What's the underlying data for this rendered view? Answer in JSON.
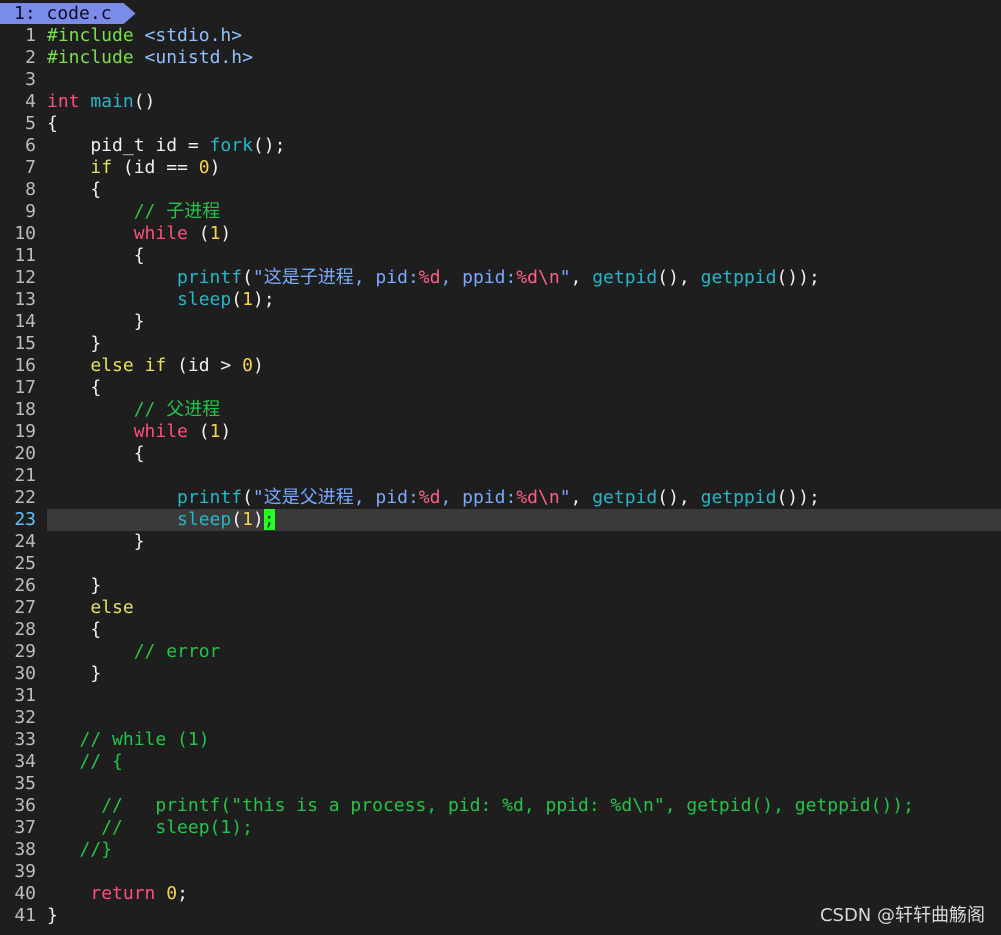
{
  "app": {
    "tab_label": "1: code.c",
    "watermark": "CSDN @轩轩曲觞阁",
    "current_line": 23
  },
  "colors": {
    "background": "#1e1e1e",
    "line_number": "#bdbdbd",
    "current_line_number": "#66c2ff",
    "preprocessor": "#79e04a",
    "include_path": "#8fc1ff",
    "keyword": "#ff4f7a",
    "control": "#e6e05a",
    "function": "#25b6c8",
    "number": "#f4d547",
    "comment": "#22c54a",
    "string": "#7aa8ff",
    "format_specifier": "#ff5f86",
    "cursor": "#22ff22"
  },
  "lines": [
    {
      "number": "1",
      "tokens": [
        {
          "text": "#include",
          "type": "pre"
        },
        {
          "text": " ",
          "type": "txt"
        },
        {
          "text": "<stdio.h>",
          "type": "inc"
        }
      ]
    },
    {
      "number": "2",
      "tokens": [
        {
          "text": "#include",
          "type": "pre"
        },
        {
          "text": " ",
          "type": "txt"
        },
        {
          "text": "<unistd.h>",
          "type": "inc"
        }
      ]
    },
    {
      "number": "3",
      "tokens": []
    },
    {
      "number": "4",
      "tokens": [
        {
          "text": "int",
          "type": "kw"
        },
        {
          "text": " ",
          "type": "txt"
        },
        {
          "text": "main",
          "type": "fn"
        },
        {
          "text": "()",
          "type": "txt"
        }
      ]
    },
    {
      "number": "5",
      "tokens": [
        {
          "text": "{",
          "type": "txt"
        }
      ]
    },
    {
      "number": "6",
      "tokens": [
        {
          "text": "    pid_t id = ",
          "type": "txt"
        },
        {
          "text": "fork",
          "type": "fn"
        },
        {
          "text": "();",
          "type": "txt"
        }
      ]
    },
    {
      "number": "7",
      "tokens": [
        {
          "text": "    ",
          "type": "txt"
        },
        {
          "text": "if",
          "type": "ctl"
        },
        {
          "text": " (id == ",
          "type": "txt"
        },
        {
          "text": "0",
          "type": "num"
        },
        {
          "text": ")",
          "type": "txt"
        }
      ]
    },
    {
      "number": "8",
      "tokens": [
        {
          "text": "    {",
          "type": "txt"
        }
      ]
    },
    {
      "number": "9",
      "tokens": [
        {
          "text": "        ",
          "type": "txt"
        },
        {
          "text": "// 子进程",
          "type": "com"
        }
      ]
    },
    {
      "number": "10",
      "tokens": [
        {
          "text": "        ",
          "type": "txt"
        },
        {
          "text": "while",
          "type": "kw"
        },
        {
          "text": " (",
          "type": "txt"
        },
        {
          "text": "1",
          "type": "num"
        },
        {
          "text": ")",
          "type": "txt"
        }
      ]
    },
    {
      "number": "11",
      "tokens": [
        {
          "text": "        {",
          "type": "txt"
        }
      ]
    },
    {
      "number": "12",
      "tokens": [
        {
          "text": "            ",
          "type": "txt"
        },
        {
          "text": "printf",
          "type": "fn"
        },
        {
          "text": "(",
          "type": "txt"
        },
        {
          "text": "\"这是子进程, pid:",
          "type": "str"
        },
        {
          "text": "%d",
          "type": "esc"
        },
        {
          "text": ", ppid:",
          "type": "str"
        },
        {
          "text": "%d\\n",
          "type": "esc"
        },
        {
          "text": "\"",
          "type": "str"
        },
        {
          "text": ", ",
          "type": "txt"
        },
        {
          "text": "getpid",
          "type": "fn"
        },
        {
          "text": "(), ",
          "type": "txt"
        },
        {
          "text": "getppid",
          "type": "fn"
        },
        {
          "text": "());",
          "type": "txt"
        }
      ]
    },
    {
      "number": "13",
      "tokens": [
        {
          "text": "            ",
          "type": "txt"
        },
        {
          "text": "sleep",
          "type": "fn"
        },
        {
          "text": "(",
          "type": "txt"
        },
        {
          "text": "1",
          "type": "num"
        },
        {
          "text": ");",
          "type": "txt"
        }
      ]
    },
    {
      "number": "14",
      "tokens": [
        {
          "text": "        }",
          "type": "txt"
        }
      ]
    },
    {
      "number": "15",
      "tokens": [
        {
          "text": "    }",
          "type": "txt"
        }
      ]
    },
    {
      "number": "16",
      "tokens": [
        {
          "text": "    ",
          "type": "txt"
        },
        {
          "text": "else",
          "type": "ctl"
        },
        {
          "text": " ",
          "type": "txt"
        },
        {
          "text": "if",
          "type": "ctl"
        },
        {
          "text": " (id > ",
          "type": "txt"
        },
        {
          "text": "0",
          "type": "num"
        },
        {
          "text": ")",
          "type": "txt"
        }
      ]
    },
    {
      "number": "17",
      "tokens": [
        {
          "text": "    {",
          "type": "txt"
        }
      ]
    },
    {
      "number": "18",
      "tokens": [
        {
          "text": "        ",
          "type": "txt"
        },
        {
          "text": "// 父进程",
          "type": "com"
        }
      ]
    },
    {
      "number": "19",
      "tokens": [
        {
          "text": "        ",
          "type": "txt"
        },
        {
          "text": "while",
          "type": "kw"
        },
        {
          "text": " (",
          "type": "txt"
        },
        {
          "text": "1",
          "type": "num"
        },
        {
          "text": ")",
          "type": "txt"
        }
      ]
    },
    {
      "number": "20",
      "tokens": [
        {
          "text": "        {",
          "type": "txt"
        }
      ]
    },
    {
      "number": "21",
      "tokens": []
    },
    {
      "number": "22",
      "tokens": [
        {
          "text": "            ",
          "type": "txt"
        },
        {
          "text": "printf",
          "type": "fn"
        },
        {
          "text": "(",
          "type": "txt"
        },
        {
          "text": "\"这是父进程, pid:",
          "type": "str"
        },
        {
          "text": "%d",
          "type": "esc"
        },
        {
          "text": ", ppid:",
          "type": "str"
        },
        {
          "text": "%d\\n",
          "type": "esc"
        },
        {
          "text": "\"",
          "type": "str"
        },
        {
          "text": ", ",
          "type": "txt"
        },
        {
          "text": "getpid",
          "type": "fn"
        },
        {
          "text": "(), ",
          "type": "txt"
        },
        {
          "text": "getppid",
          "type": "fn"
        },
        {
          "text": "());",
          "type": "txt"
        }
      ]
    },
    {
      "number": "23",
      "tokens": [
        {
          "text": "            ",
          "type": "txt"
        },
        {
          "text": "sleep",
          "type": "fn"
        },
        {
          "text": "(",
          "type": "txt"
        },
        {
          "text": "1",
          "type": "num"
        },
        {
          "text": ")",
          "type": "txt"
        },
        {
          "text": ";",
          "type": "cursor"
        }
      ]
    },
    {
      "number": "24",
      "tokens": [
        {
          "text": "        }",
          "type": "txt"
        }
      ]
    },
    {
      "number": "25",
      "tokens": []
    },
    {
      "number": "26",
      "tokens": [
        {
          "text": "    }",
          "type": "txt"
        }
      ]
    },
    {
      "number": "27",
      "tokens": [
        {
          "text": "    ",
          "type": "txt"
        },
        {
          "text": "else",
          "type": "ctl"
        }
      ]
    },
    {
      "number": "28",
      "tokens": [
        {
          "text": "    {",
          "type": "txt"
        }
      ]
    },
    {
      "number": "29",
      "tokens": [
        {
          "text": "        ",
          "type": "txt"
        },
        {
          "text": "// error",
          "type": "com"
        }
      ]
    },
    {
      "number": "30",
      "tokens": [
        {
          "text": "    }",
          "type": "txt"
        }
      ]
    },
    {
      "number": "31",
      "tokens": []
    },
    {
      "number": "32",
      "tokens": []
    },
    {
      "number": "33",
      "tokens": [
        {
          "text": "   ",
          "type": "txt"
        },
        {
          "text": "// while (1)",
          "type": "com"
        }
      ]
    },
    {
      "number": "34",
      "tokens": [
        {
          "text": "   ",
          "type": "txt"
        },
        {
          "text": "// {",
          "type": "com"
        }
      ]
    },
    {
      "number": "35",
      "tokens": []
    },
    {
      "number": "36",
      "tokens": [
        {
          "text": "     ",
          "type": "txt"
        },
        {
          "text": "//   printf(\"this is a process, pid: %d, ppid: %d\\n\", getpid(), getppid());",
          "type": "com"
        }
      ]
    },
    {
      "number": "37",
      "tokens": [
        {
          "text": "     ",
          "type": "txt"
        },
        {
          "text": "//   sleep(1);",
          "type": "com"
        }
      ]
    },
    {
      "number": "38",
      "tokens": [
        {
          "text": "   ",
          "type": "txt"
        },
        {
          "text": "//}",
          "type": "com"
        }
      ]
    },
    {
      "number": "39",
      "tokens": []
    },
    {
      "number": "40",
      "tokens": [
        {
          "text": "    ",
          "type": "txt"
        },
        {
          "text": "return",
          "type": "kw"
        },
        {
          "text": " ",
          "type": "txt"
        },
        {
          "text": "0",
          "type": "num"
        },
        {
          "text": ";",
          "type": "txt"
        }
      ]
    },
    {
      "number": "41",
      "tokens": [
        {
          "text": "}",
          "type": "txt"
        }
      ]
    }
  ]
}
